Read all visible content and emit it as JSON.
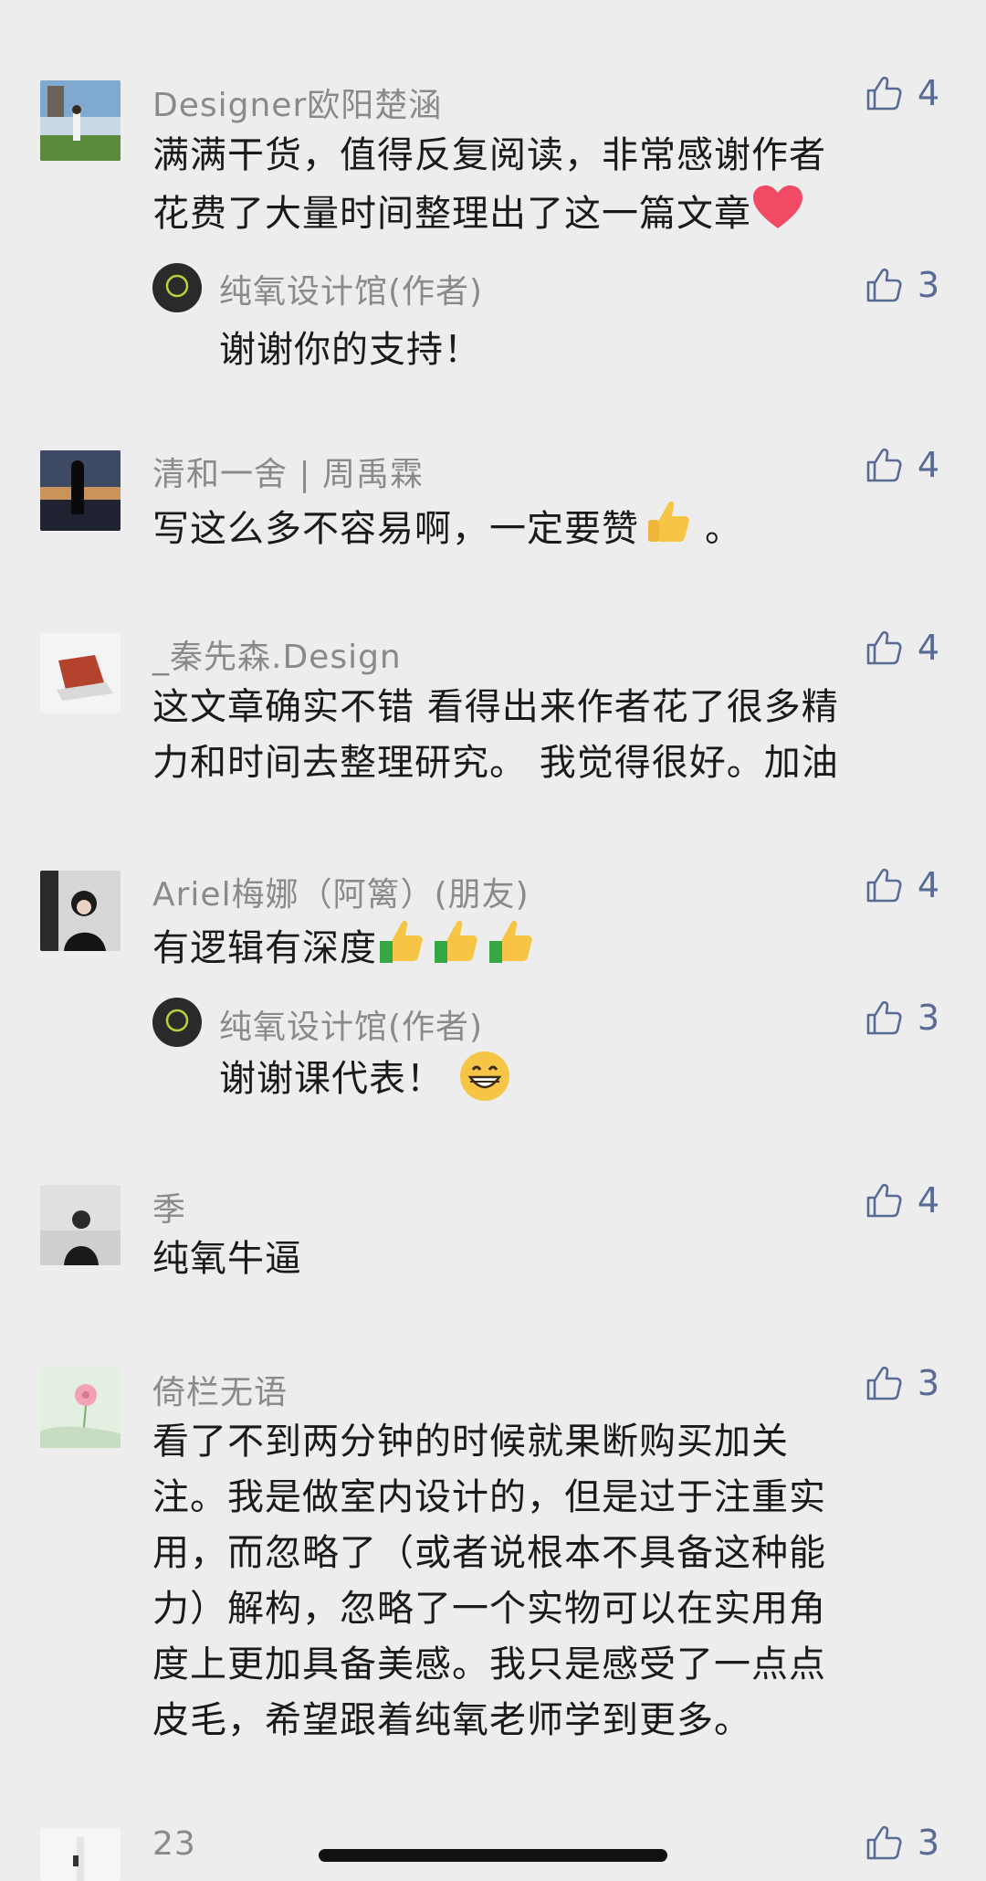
{
  "comments": [
    {
      "name": "Designer欧阳楚涵",
      "text_l1": "满满干货，值得反复阅读，非常感谢作者",
      "text_l2": "花费了大量时间整理出了这一篇文章",
      "likes": "4",
      "reply": {
        "name": "纯氧设计馆(作者)",
        "text": "谢谢你的支持！",
        "likes": "3"
      }
    },
    {
      "name": "清和一舍 | 周禹霖",
      "text": "写这么多不容易啊，一定要赞",
      "text_tail": "。",
      "likes": "4"
    },
    {
      "name": "_秦先森.Design",
      "text_l1": "这文章确实不错 看得出来作者花了很多精",
      "text_l2": "力和时间去整理研究。 我觉得很好。加油",
      "likes": "4"
    },
    {
      "name": "Ariel梅娜（阿篱）(朋友)",
      "text": "有逻辑有深度",
      "likes": "4",
      "reply": {
        "name": "纯氧设计馆(作者)",
        "text": "谢谢课代表！",
        "likes": "3"
      }
    },
    {
      "name": "季",
      "text": "纯氧牛逼",
      "likes": "4"
    },
    {
      "name": "倚栏无语",
      "lines": [
        "看了不到两分钟的时候就果断购买加关",
        "注。我是做室内设计的，但是过于注重实",
        "用，而忽略了（或者说根本不具备这种能",
        "力）解构，忽略了一个实物可以在实用角",
        "度上更加具备美感。我只是感受了一点点",
        "皮毛，希望跟着纯氧老师学到更多。"
      ],
      "likes": "3"
    },
    {
      "name": "23",
      "likes": "3"
    }
  ],
  "icons": {
    "like": "thumbs-up-outline-icon",
    "heart": "heart-emoji",
    "thumbs": "thumbs-up-emoji",
    "grin": "grinning-emoji"
  },
  "colors": {
    "background": "#ededed",
    "name": "#8a8a8a",
    "text": "#1a1a1a",
    "like": "#576b95"
  }
}
